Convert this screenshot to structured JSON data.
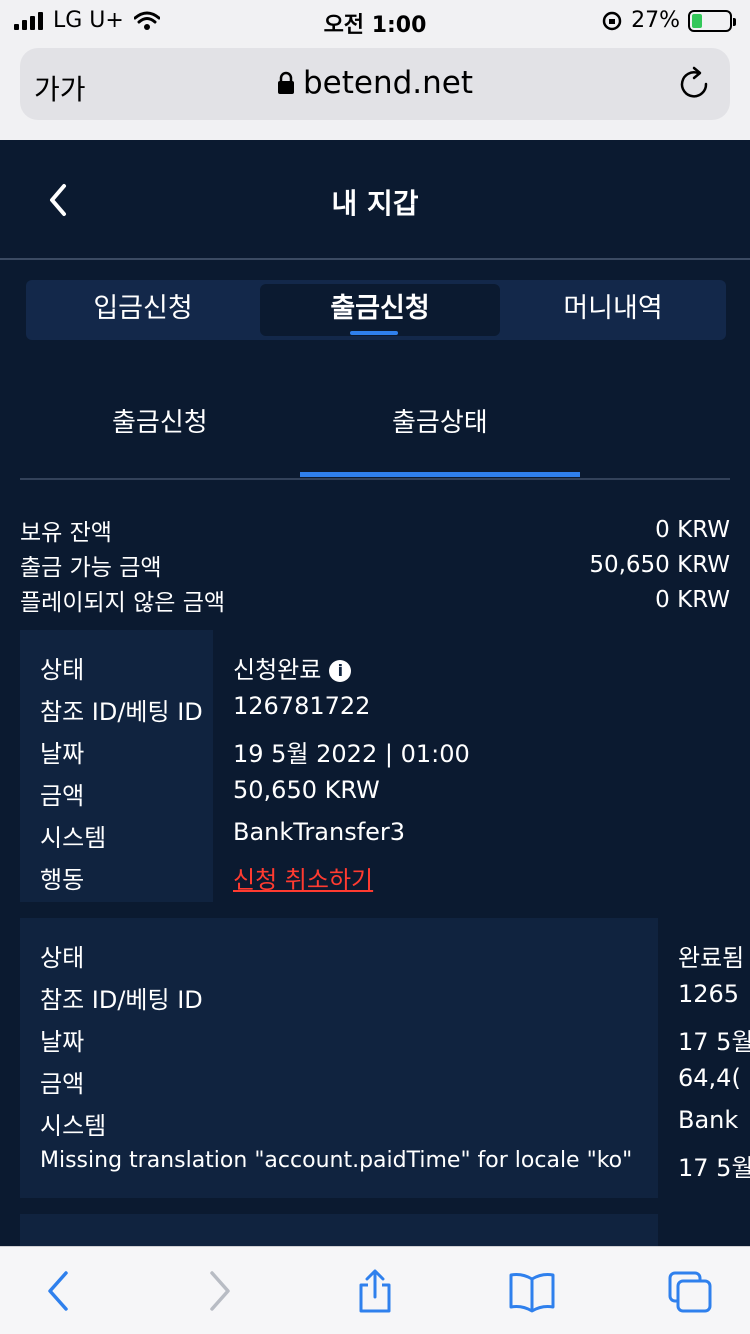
{
  "status_bar": {
    "carrier": "LG U+",
    "time": "오전 1:00",
    "battery_percent": "27%",
    "battery_level": 0.27
  },
  "browser": {
    "text_size_label": "가가",
    "url": "betend.net"
  },
  "header": {
    "title": "내 지갑"
  },
  "main_tabs": [
    {
      "label": "입금신청",
      "active": false
    },
    {
      "label": "출금신청",
      "active": true
    },
    {
      "label": "머니내역",
      "active": false
    }
  ],
  "sub_tabs": [
    {
      "label": "출금신청",
      "active": false
    },
    {
      "label": "출금상태",
      "active": true
    }
  ],
  "balance": [
    {
      "label": "보유 잔액",
      "value": "0 KRW"
    },
    {
      "label": "출금 가능 금액",
      "value": "50,650 KRW"
    },
    {
      "label": "플레이되지 않은 금액",
      "value": "0 KRW"
    }
  ],
  "records": [
    {
      "rows": [
        {
          "label": "상태",
          "value": "신청완료"
        },
        {
          "label": "참조 ID/베팅 ID",
          "value": "126781722"
        },
        {
          "label": "날짜",
          "value": "19 5월 2022 | 01:00"
        },
        {
          "label": "금액",
          "value": "50,650 KRW"
        },
        {
          "label": "시스템",
          "value": "BankTransfer3"
        },
        {
          "label": "행동",
          "value": "신청 취소하기"
        }
      ]
    },
    {
      "rows": [
        {
          "label": "상태",
          "value": "완료됨"
        },
        {
          "label": "참조 ID/베팅 ID",
          "value": "1265"
        },
        {
          "label": "날짜",
          "value": "17 5월"
        },
        {
          "label": "금액",
          "value": "64,4("
        },
        {
          "label": "시스템",
          "value": "Bank"
        },
        {
          "label": "Missing translation \"account.paidTime\" for locale \"ko\"",
          "value": "17 5월"
        }
      ]
    }
  ],
  "colors": {
    "background": "#0b1a30",
    "card": "#10233f",
    "accent": "#2f80ed",
    "cancel": "#ff3b30"
  }
}
